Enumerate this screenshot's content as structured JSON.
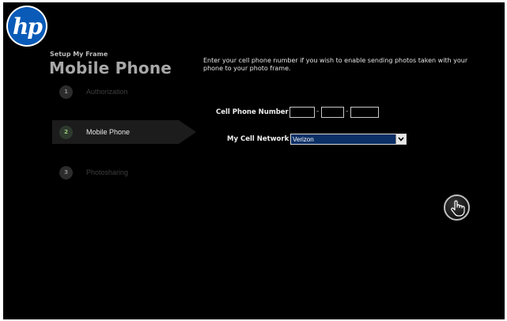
{
  "logo": {
    "text": "hp"
  },
  "header": {
    "setup_label": "Setup My Frame",
    "title": "Mobile Phone"
  },
  "steps": [
    {
      "number": "1",
      "label": "Authorization",
      "active": false
    },
    {
      "number": "2",
      "label": "Mobile Phone",
      "active": true
    },
    {
      "number": "3",
      "label": "Photosharing",
      "active": false
    }
  ],
  "main": {
    "instructions": "Enter your cell phone number if you wish to enable sending photos taken with your phone to your photo frame.",
    "phone_label": "Cell Phone Number",
    "phone_separator": "-",
    "phone_parts": [
      "",
      "",
      ""
    ],
    "network_label": "My Cell Network",
    "network_value": "Verizon"
  },
  "icons": {
    "select_arrow": "chevron-down-icon",
    "hand": "hand-pointer-icon"
  },
  "colors": {
    "background": "#000000",
    "logo_blue": "#0a5bb8",
    "active_step": "#1c1c1c",
    "select_bg": "#0b2f66"
  }
}
